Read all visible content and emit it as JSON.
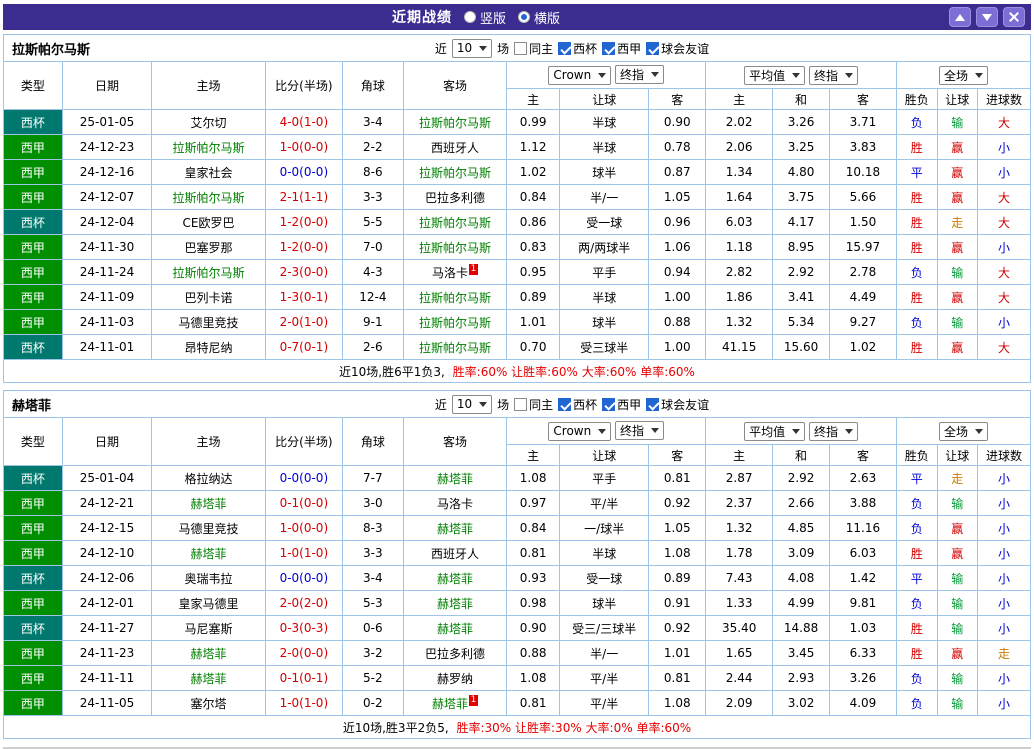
{
  "titlebar": {
    "title": "近期战绩",
    "vertical": "竖版",
    "horizontal": "横版"
  },
  "filters": {
    "near": "近",
    "count": "10",
    "unit": "场",
    "same_home": "同主",
    "cup": "西杯",
    "league": "西甲",
    "friendly": "球会友谊"
  },
  "headers": {
    "type": "类型",
    "date": "日期",
    "home": "主场",
    "score": "比分(半场)",
    "corner": "角球",
    "away": "客场",
    "bookmaker": "Crown",
    "final_odds": "终指",
    "average": "平均值",
    "final_odds2": "终指",
    "full": "全场",
    "h": "主",
    "handicap": "让球",
    "a": "客",
    "avg_h": "主",
    "avg_d": "和",
    "avg_a": "客",
    "result": "胜负",
    "handicap_result": "让球",
    "goals": "进球数"
  },
  "colors": {
    "titlebar_bg": "#3b2d90",
    "titlebar_button_bg": "#7b6fd6",
    "table_border": "#9ec5e8",
    "cup_bg": "#00786e",
    "league_bg": "#008f00",
    "focal_team": "#008000",
    "win_red": "#d40000",
    "draw_blue": "#0000d4",
    "lose_green": "#009933",
    "walk_orange": "#c87a00",
    "summary_red": "#e60000",
    "checkbox_blue": "#2166d1"
  },
  "sections": [
    {
      "team": "拉斯帕尔马斯",
      "summary_prefix": "近10场,胜6平1负3,",
      "summary_rates": "胜率:60% 让胜率:60% 大率:60% 单率:60%",
      "rows": [
        {
          "cells": [
            "西杯",
            "25-01-05",
            "艾尔切",
            "4-0(1-0)",
            "3-4",
            "拉斯帕尔马斯",
            "0.99",
            "半球",
            "0.90",
            "2.02",
            "3.26",
            "3.71",
            "负",
            "输",
            "大"
          ],
          "styles": {
            "0": "cup",
            "3": "r",
            "5": "g",
            "12": "b",
            "13": "grn",
            "14": "r"
          }
        },
        {
          "cells": [
            "西甲",
            "24-12-23",
            "拉斯帕尔马斯",
            "1-0(0-0)",
            "2-2",
            "西班牙人",
            "1.12",
            "半球",
            "0.78",
            "2.06",
            "3.25",
            "3.83",
            "胜",
            "赢",
            "小"
          ],
          "styles": {
            "0": "lg",
            "2": "g",
            "3": "r",
            "12": "r",
            "13": "r",
            "14": "b"
          }
        },
        {
          "cells": [
            "西甲",
            "24-12-16",
            "皇家社会",
            "0-0(0-0)",
            "8-6",
            "拉斯帕尔马斯",
            "1.02",
            "球半",
            "0.87",
            "1.34",
            "4.80",
            "10.18",
            "平",
            "赢",
            "小"
          ],
          "styles": {
            "0": "lg",
            "3": "b",
            "5": "g",
            "12": "b",
            "13": "r",
            "14": "b"
          }
        },
        {
          "cells": [
            "西甲",
            "24-12-07",
            "拉斯帕尔马斯",
            "2-1(1-1)",
            "3-3",
            "巴拉多利德",
            "0.84",
            "半/一",
            "1.05",
            "1.64",
            "3.75",
            "5.66",
            "胜",
            "赢",
            "大"
          ],
          "styles": {
            "0": "lg",
            "2": "g",
            "3": "r",
            "12": "r",
            "13": "r",
            "14": "r"
          }
        },
        {
          "cells": [
            "西杯",
            "24-12-04",
            "CE欧罗巴",
            "1-2(0-0)",
            "5-5",
            "拉斯帕尔马斯",
            "0.86",
            "受一球",
            "0.96",
            "6.03",
            "4.17",
            "1.50",
            "胜",
            "走",
            "大"
          ],
          "styles": {
            "0": "cup",
            "3": "r",
            "5": "g",
            "12": "r",
            "13": "or",
            "14": "r"
          }
        },
        {
          "cells": [
            "西甲",
            "24-11-30",
            "巴塞罗那",
            "1-2(0-0)",
            "7-0",
            "拉斯帕尔马斯",
            "0.83",
            "两/两球半",
            "1.06",
            "1.18",
            "8.95",
            "15.97",
            "胜",
            "赢",
            "小"
          ],
          "styles": {
            "0": "lg",
            "3": "r",
            "5": "g",
            "12": "r",
            "13": "r",
            "14": "b"
          }
        },
        {
          "cells": [
            "西甲",
            "24-11-24",
            "拉斯帕尔马斯",
            "2-3(0-0)",
            "4-3",
            "马洛卡",
            "0.95",
            "平手",
            "0.94",
            "2.82",
            "2.92",
            "2.78",
            "负",
            "输",
            "大"
          ],
          "styles": {
            "0": "lg",
            "2": "g",
            "3": "r",
            "12": "b",
            "13": "grn",
            "14": "r"
          },
          "cards": {
            "5": "1"
          }
        },
        {
          "cells": [
            "西甲",
            "24-11-09",
            "巴列卡诺",
            "1-3(0-1)",
            "12-4",
            "拉斯帕尔马斯",
            "0.89",
            "半球",
            "1.00",
            "1.86",
            "3.41",
            "4.49",
            "胜",
            "赢",
            "大"
          ],
          "styles": {
            "0": "lg",
            "3": "r",
            "5": "g",
            "12": "r",
            "13": "r",
            "14": "r"
          }
        },
        {
          "cells": [
            "西甲",
            "24-11-03",
            "马德里竞技",
            "2-0(1-0)",
            "9-1",
            "拉斯帕尔马斯",
            "1.01",
            "球半",
            "0.88",
            "1.32",
            "5.34",
            "9.27",
            "负",
            "输",
            "小"
          ],
          "styles": {
            "0": "lg",
            "3": "r",
            "5": "g",
            "12": "b",
            "13": "grn",
            "14": "b"
          }
        },
        {
          "cells": [
            "西杯",
            "24-11-01",
            "昂特尼纳",
            "0-7(0-1)",
            "2-6",
            "拉斯帕尔马斯",
            "0.70",
            "受三球半",
            "1.00",
            "41.15",
            "15.60",
            "1.02",
            "胜",
            "赢",
            "大"
          ],
          "styles": {
            "0": "cup",
            "3": "r",
            "5": "g",
            "12": "r",
            "13": "r",
            "14": "r"
          }
        }
      ]
    },
    {
      "team": "赫塔菲",
      "summary_prefix": "近10场,胜3平2负5,",
      "summary_rates": "胜率:30% 让胜率:30% 大率:0% 单率:60%",
      "rows": [
        {
          "cells": [
            "西杯",
            "25-01-04",
            "格拉纳达",
            "0-0(0-0)",
            "7-7",
            "赫塔菲",
            "1.08",
            "平手",
            "0.81",
            "2.87",
            "2.92",
            "2.63",
            "平",
            "走",
            "小"
          ],
          "styles": {
            "0": "cup",
            "3": "b",
            "5": "g",
            "12": "b",
            "13": "or",
            "14": "b"
          }
        },
        {
          "cells": [
            "西甲",
            "24-12-21",
            "赫塔菲",
            "0-1(0-0)",
            "3-0",
            "马洛卡",
            "0.97",
            "平/半",
            "0.92",
            "2.37",
            "2.66",
            "3.88",
            "负",
            "输",
            "小"
          ],
          "styles": {
            "0": "lg",
            "2": "g",
            "3": "r",
            "12": "b",
            "13": "grn",
            "14": "b"
          }
        },
        {
          "cells": [
            "西甲",
            "24-12-15",
            "马德里竞技",
            "1-0(0-0)",
            "8-3",
            "赫塔菲",
            "0.84",
            "一/球半",
            "1.05",
            "1.32",
            "4.85",
            "11.16",
            "负",
            "赢",
            "小"
          ],
          "styles": {
            "0": "lg",
            "3": "r",
            "5": "g",
            "12": "b",
            "13": "r",
            "14": "b"
          }
        },
        {
          "cells": [
            "西甲",
            "24-12-10",
            "赫塔菲",
            "1-0(1-0)",
            "3-3",
            "西班牙人",
            "0.81",
            "半球",
            "1.08",
            "1.78",
            "3.09",
            "6.03",
            "胜",
            "赢",
            "小"
          ],
          "styles": {
            "0": "lg",
            "2": "g",
            "3": "r",
            "12": "r",
            "13": "r",
            "14": "b"
          }
        },
        {
          "cells": [
            "西杯",
            "24-12-06",
            "奥瑞韦拉",
            "0-0(0-0)",
            "3-4",
            "赫塔菲",
            "0.93",
            "受一球",
            "0.89",
            "7.43",
            "4.08",
            "1.42",
            "平",
            "输",
            "小"
          ],
          "styles": {
            "0": "cup",
            "3": "b",
            "5": "g",
            "12": "b",
            "13": "grn",
            "14": "b"
          }
        },
        {
          "cells": [
            "西甲",
            "24-12-01",
            "皇家马德里",
            "2-0(2-0)",
            "5-3",
            "赫塔菲",
            "0.98",
            "球半",
            "0.91",
            "1.33",
            "4.99",
            "9.81",
            "负",
            "输",
            "小"
          ],
          "styles": {
            "0": "lg",
            "3": "r",
            "5": "g",
            "12": "b",
            "13": "grn",
            "14": "b"
          }
        },
        {
          "cells": [
            "西杯",
            "24-11-27",
            "马尼塞斯",
            "0-3(0-3)",
            "0-6",
            "赫塔菲",
            "0.90",
            "受三/三球半",
            "0.92",
            "35.40",
            "14.88",
            "1.03",
            "胜",
            "输",
            "小"
          ],
          "styles": {
            "0": "cup",
            "3": "r",
            "5": "g",
            "12": "r",
            "13": "grn",
            "14": "b"
          }
        },
        {
          "cells": [
            "西甲",
            "24-11-23",
            "赫塔菲",
            "2-0(0-0)",
            "3-2",
            "巴拉多利德",
            "0.88",
            "半/一",
            "1.01",
            "1.65",
            "3.45",
            "6.33",
            "胜",
            "赢",
            "走"
          ],
          "styles": {
            "0": "lg",
            "2": "g",
            "3": "r",
            "12": "r",
            "13": "r",
            "14": "or"
          }
        },
        {
          "cells": [
            "西甲",
            "24-11-11",
            "赫塔菲",
            "0-1(0-1)",
            "5-2",
            "赫罗纳",
            "1.08",
            "平/半",
            "0.81",
            "2.44",
            "2.93",
            "3.26",
            "负",
            "输",
            "小"
          ],
          "styles": {
            "0": "lg",
            "2": "g",
            "3": "r",
            "12": "b",
            "13": "grn",
            "14": "b"
          }
        },
        {
          "cells": [
            "西甲",
            "24-11-05",
            "塞尔塔",
            "1-0(1-0)",
            "0-2",
            "赫塔菲",
            "0.81",
            "平/半",
            "1.08",
            "2.09",
            "3.02",
            "4.09",
            "负",
            "输",
            "小"
          ],
          "styles": {
            "0": "lg",
            "3": "r",
            "5": "g",
            "12": "b",
            "13": "grn",
            "14": "b"
          },
          "cards": {
            "5": "1"
          }
        }
      ]
    }
  ]
}
